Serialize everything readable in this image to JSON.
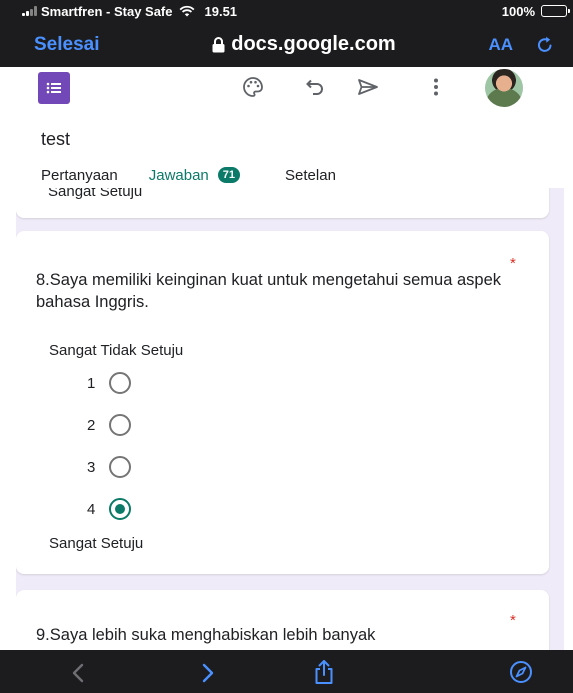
{
  "status_bar": {
    "carrier": "Smartfren - Stay Safe",
    "time": "19.51",
    "battery": "100%"
  },
  "browser": {
    "done_label": "Selesai",
    "url": "docs.google.com",
    "text_size_label": "AA"
  },
  "form": {
    "title": "test",
    "tabs": {
      "questions": "Pertanyaan",
      "responses": "Jawaban",
      "responses_count": "71",
      "settings": "Setelan"
    }
  },
  "previous_card": {
    "partial_label": "Sangat Setuju"
  },
  "question_8": {
    "text": "8.Saya memiliki keinginan kuat untuk mengetahui semua aspek bahasa Inggris.",
    "required_mark": "*",
    "low_label": "Sangat Tidak Setuju",
    "high_label": "Sangat Setuju",
    "options": [
      "1",
      "2",
      "3",
      "4"
    ],
    "selected": "4"
  },
  "question_9": {
    "text": "9.Saya lebih suka menghabiskan lebih banyak",
    "required_mark": "*"
  },
  "colors": {
    "accent": "#0b7a68",
    "form_purple": "#7248b9",
    "background": "#f0ebf8",
    "required": "#d93025",
    "browser_link": "#4a90ff"
  },
  "icons": [
    "palette-icon",
    "undo-icon",
    "send-icon",
    "more-vert-icon",
    "lock-icon",
    "reload-icon",
    "back-icon",
    "forward-icon",
    "share-icon",
    "compass-icon"
  ]
}
